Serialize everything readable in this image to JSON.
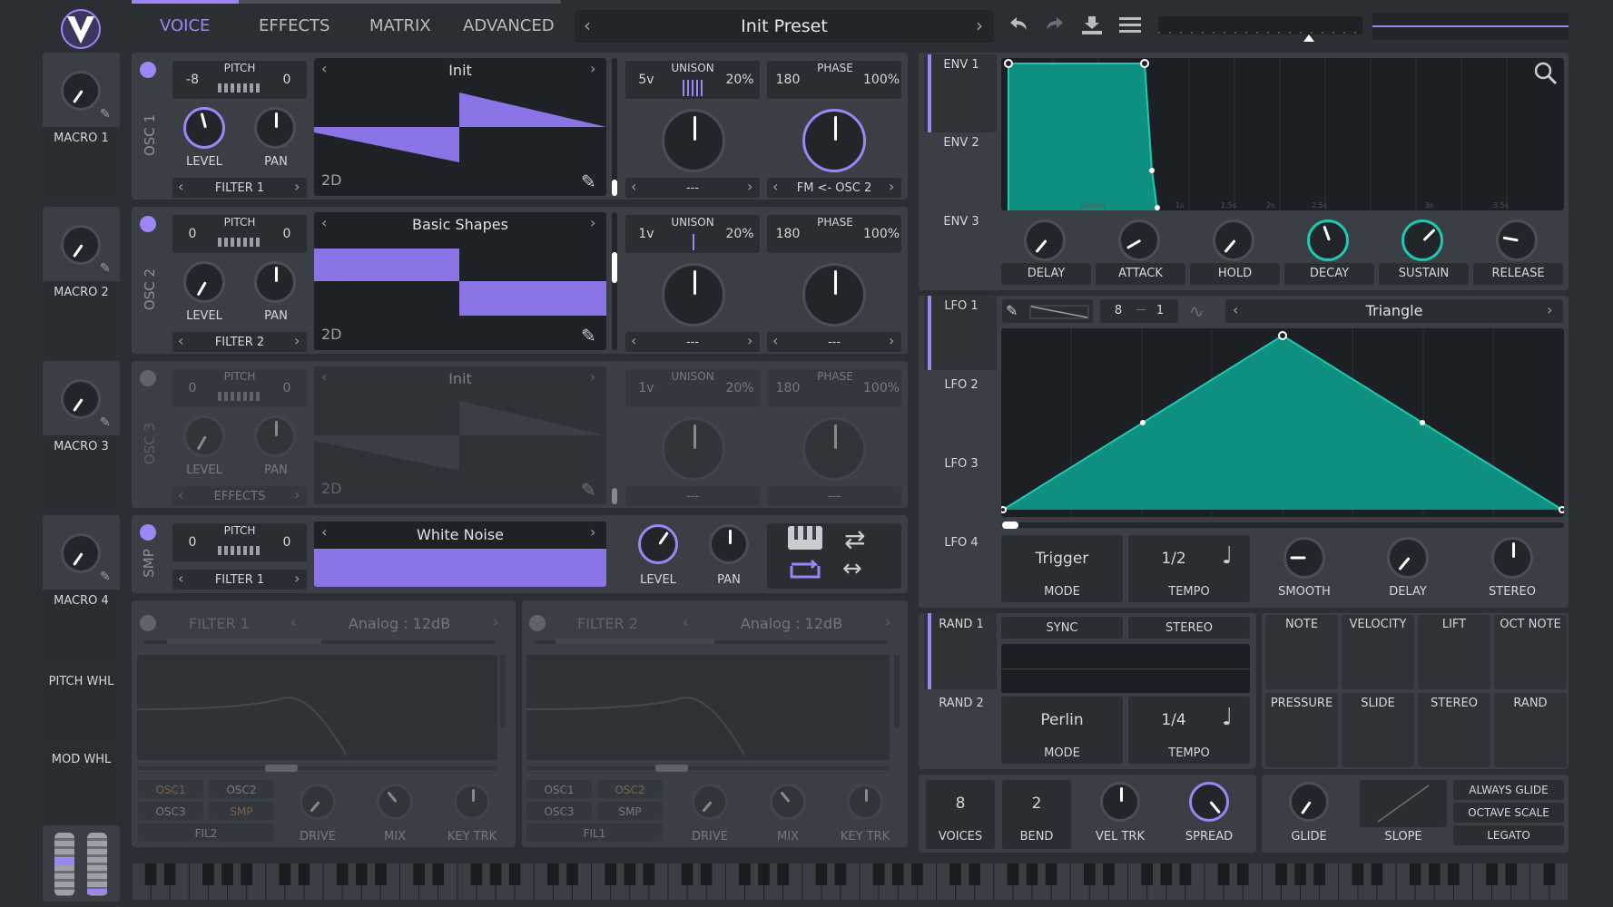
{
  "tabs": [
    "VOICE",
    "EFFECTS",
    "MATRIX",
    "ADVANCED"
  ],
  "preset": {
    "name": "Init Preset"
  },
  "macros": [
    "MACRO 1",
    "MACRO 2",
    "MACRO 3",
    "MACRO 4"
  ],
  "wheels": {
    "pitch": "PITCH WHL",
    "mod": "MOD WHL"
  },
  "osc": [
    {
      "name": "OSC 1",
      "transpose": "-8",
      "tune": "0",
      "pitch_label": "PITCH",
      "wavetable": "Init",
      "dim": "2D",
      "level": "LEVEL",
      "pan": "PAN",
      "dest": "FILTER 1",
      "unison_voices": "5v",
      "unison_label": "UNISON",
      "unison_detune": "20%",
      "phase": "180",
      "phase_label": "PHASE",
      "phase_rand": "100%",
      "unison_dest": "---",
      "phase_dest": "FM <- OSC 2"
    },
    {
      "name": "OSC 2",
      "transpose": "0",
      "tune": "0",
      "pitch_label": "PITCH",
      "wavetable": "Basic Shapes",
      "dim": "2D",
      "level": "LEVEL",
      "pan": "PAN",
      "dest": "FILTER 2",
      "unison_voices": "1v",
      "unison_label": "UNISON",
      "unison_detune": "20%",
      "phase": "180",
      "phase_label": "PHASE",
      "phase_rand": "100%",
      "unison_dest": "---",
      "phase_dest": "---"
    },
    {
      "name": "OSC 3",
      "transpose": "0",
      "tune": "0",
      "pitch_label": "PITCH",
      "wavetable": "Init",
      "dim": "2D",
      "level": "LEVEL",
      "pan": "PAN",
      "dest": "EFFECTS",
      "unison_voices": "1v",
      "unison_label": "UNISON",
      "unison_detune": "20%",
      "phase": "180",
      "phase_label": "PHASE",
      "phase_rand": "100%",
      "unison_dest": "---",
      "phase_dest": "---"
    }
  ],
  "smp": {
    "name": "SMP",
    "transpose": "0",
    "tune": "0",
    "pitch_label": "PITCH",
    "sample": "White Noise",
    "dest": "FILTER 1",
    "level": "LEVEL",
    "pan": "PAN"
  },
  "filters": [
    {
      "name": "FILTER 1",
      "model": "Analog : 12dB",
      "routes": [
        "OSC1",
        "OSC2",
        "OSC3",
        "SMP"
      ],
      "extra": "FIL2",
      "drive": "DRIVE",
      "mix": "MIX",
      "keytrk": "KEY TRK"
    },
    {
      "name": "FILTER 2",
      "model": "Analog : 12dB",
      "routes": [
        "OSC1",
        "OSC2",
        "OSC3",
        "SMP"
      ],
      "extra": "FIL1",
      "drive": "DRIVE",
      "mix": "MIX",
      "keytrk": "KEY TRK"
    }
  ],
  "env": {
    "tabs": [
      "ENV 1",
      "ENV 2",
      "ENV 3"
    ],
    "knobs": [
      "DELAY",
      "ATTACK",
      "HOLD",
      "DECAY",
      "SUSTAIN",
      "RELEASE"
    ],
    "time_marks": [
      "500ms",
      "1s",
      "1.5s",
      "2s",
      "2.5s",
      "3s",
      "3.5s"
    ]
  },
  "lfo": {
    "tabs": [
      "LFO 1",
      "LFO 2",
      "LFO 3",
      "LFO 4"
    ],
    "grid_x": "8",
    "grid_y": "1",
    "shape": "Triangle",
    "mode_value": "Trigger",
    "mode_label": "MODE",
    "tempo_value": "1/2",
    "tempo_label": "TEMPO",
    "knobs": [
      "SMOOTH",
      "DELAY",
      "STEREO"
    ]
  },
  "rand": {
    "tabs": [
      "RAND 1",
      "RAND 2"
    ],
    "sync": "SYNC",
    "stereo": "STEREO",
    "mode_value": "Perlin",
    "mode_label": "MODE",
    "tempo_value": "1/4",
    "tempo_label": "TEMPO"
  },
  "mod_sources": [
    [
      "NOTE",
      "VELOCITY",
      "LIFT",
      "OCT NOTE"
    ],
    [
      "PRESSURE",
      "SLIDE",
      "STEREO",
      "RAND"
    ]
  ],
  "voice": {
    "voices": "8",
    "voices_label": "VOICES",
    "bend": "2",
    "bend_label": "BEND",
    "veltrk": "VEL TRK",
    "spread": "SPREAD",
    "glide": "GLIDE",
    "slope": "SLOPE",
    "options": [
      "ALWAYS GLIDE",
      "OCTAVE SCALE",
      "LEGATO"
    ]
  },
  "colors": {
    "accent": "#9b86f3",
    "teal": "#1ec9b2",
    "panel": "#3a3f45"
  }
}
